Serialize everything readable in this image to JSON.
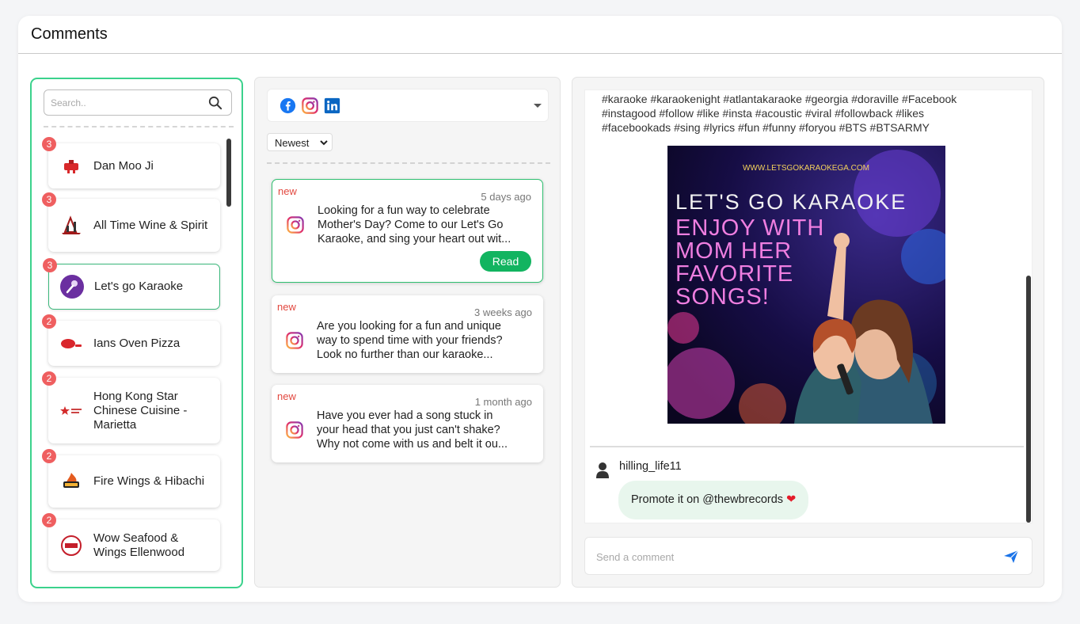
{
  "page": {
    "title": "Comments"
  },
  "search": {
    "placeholder": "Search.."
  },
  "businesses": [
    {
      "name": "Dan Moo Ji",
      "count": "3",
      "logo": "red-seal-logo"
    },
    {
      "name": "All Time Wine & Spirit",
      "count": "3",
      "logo": "wine-logo"
    },
    {
      "name": "Let's go Karaoke",
      "count": "3",
      "logo": "karaoke-logo",
      "active": true
    },
    {
      "name": "Ians Oven Pizza",
      "count": "2",
      "logo": "pizza-logo"
    },
    {
      "name": "Hong Kong Star Chinese Cuisine - Marietta",
      "count": "2",
      "logo": "hk-star-logo"
    },
    {
      "name": "Fire Wings & Hibachi",
      "count": "2",
      "logo": "fire-wings-logo"
    },
    {
      "name": "Wow Seafood & Wings Ellenwood",
      "count": "2",
      "logo": "wow-logo"
    }
  ],
  "platforms": [
    "facebook-icon",
    "instagram-icon",
    "linkedin-icon"
  ],
  "sort": {
    "label": "Newest"
  },
  "posts": [
    {
      "tag": "new",
      "time": "5 days ago",
      "lines": [
        "Looking for a fun way to celebrate",
        "Mother's Day? Come to our Let's Go",
        "Karaoke, and sing your heart out wit..."
      ],
      "action": "Read",
      "active": true
    },
    {
      "tag": "new",
      "time": "3 weeks ago",
      "lines": [
        "Are you looking for a fun and unique",
        "way to spend time with your friends?",
        "Look no further than our karaoke..."
      ]
    },
    {
      "tag": "new",
      "time": "1 month ago",
      "lines": [
        "Have you ever had a song stuck in",
        "your head that you just can't shake?",
        "Why not come with us and belt it ou..."
      ]
    }
  ],
  "detail": {
    "hashtags": [
      "#karaoke #karaokenight #atlantakaraoke #georgia #doraville #Facebook",
      "#instagood #follow #like #insta #acoustic #viral #followback #likes",
      "#facebookads #sing #lyrics #fun #funny #foryou #BTS #BTSARMY"
    ],
    "image": {
      "url": "WWW.LETSGOKARAOKEGA.COM",
      "headline": "LET'S GO KARAOKE",
      "lines": [
        "ENJOY WITH",
        "MOM HER",
        "FAVORITE",
        "SONGS!"
      ]
    },
    "comment": {
      "user": "hilling_life11",
      "text": "Promote it on @thewbrecords",
      "emoji": "❤"
    }
  },
  "composer": {
    "placeholder": "Send a comment"
  },
  "colors": {
    "accent": "#3bd28c",
    "read": "#12b460",
    "badge": "#ef5f60",
    "new": "#e2483f",
    "bubble": "#e8f6ed",
    "send": "#1a73e8"
  }
}
